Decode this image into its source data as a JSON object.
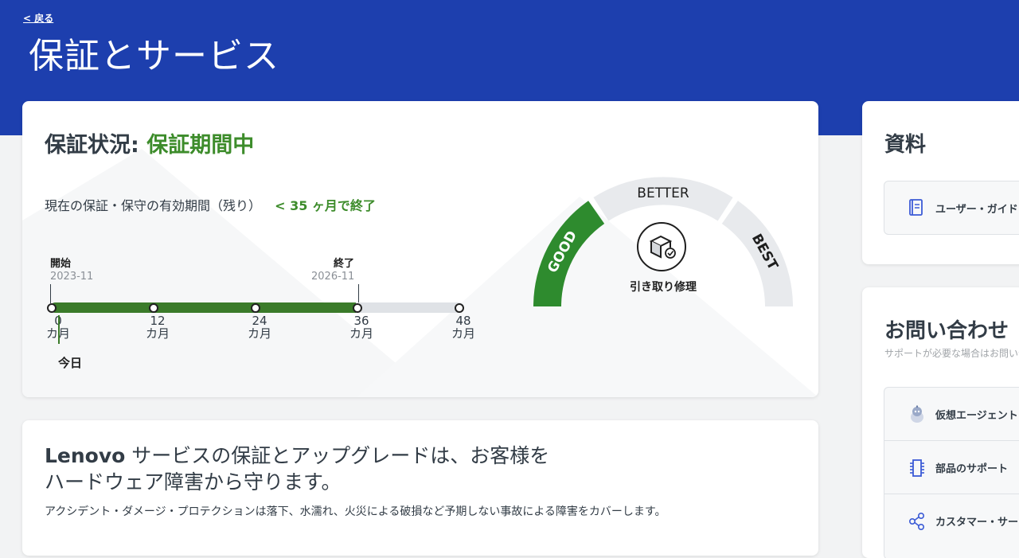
{
  "header": {
    "back_label": "< 戻る",
    "title": "保証とサービス"
  },
  "warranty": {
    "status_label": "保証状況:",
    "status_value": "保証期間中",
    "remaining_label": "現在の保証・保守の有効期間（残り）",
    "remaining_value": "< 35 ヶ月で終了",
    "timeline": {
      "start_label": "開始",
      "start_date": "2023-11",
      "end_label": "終了",
      "end_date": "2026-11",
      "total_months": 48,
      "covered_months": 36,
      "elapsed_months": 1,
      "ticks": [
        {
          "value": "0",
          "unit": "カ月"
        },
        {
          "value": "12",
          "unit": "カ月"
        },
        {
          "value": "24",
          "unit": "カ月"
        },
        {
          "value": "36",
          "unit": "カ月"
        },
        {
          "value": "48",
          "unit": "カ月"
        }
      ],
      "today_label": "今日"
    },
    "gauge": {
      "levels": [
        "GOOD",
        "BETTER",
        "BEST"
      ],
      "active_level": "GOOD",
      "service_label": "引き取り修理",
      "service_icon": "box-repair-icon",
      "active_color": "#2e8b2e",
      "inactive_color": "#e8eaed"
    }
  },
  "upgrade": {
    "title_brand": "Lenovo",
    "title_line1": " サービスの保証とアップグレードは、お客様を",
    "title_line2": "ハードウェア障害から守ります。",
    "description": "アクシデント・ダメージ・プロテクションは落下、水濡れ、火災による破損など予期しない事故による障害をカバーします。"
  },
  "resources": {
    "title": "資料",
    "items": [
      {
        "label": "ユーザー・ガイド",
        "icon": "book-icon"
      }
    ]
  },
  "contact": {
    "title": "お問い合わせ",
    "subtitle": "サポートが必要な場合はお問い合わせください",
    "items": [
      {
        "label": "仮想エージェントと",
        "icon": "robot-icon"
      },
      {
        "label": "部品のサポート",
        "icon": "chip-icon"
      },
      {
        "label": "カスタマー・サービス",
        "icon": "share-icon"
      }
    ]
  },
  "colors": {
    "header_blue": "#1d3fae",
    "status_green": "#3d8c2b",
    "timeline_green": "#3b7b2a",
    "accent_blue": "#3b5bd6"
  }
}
